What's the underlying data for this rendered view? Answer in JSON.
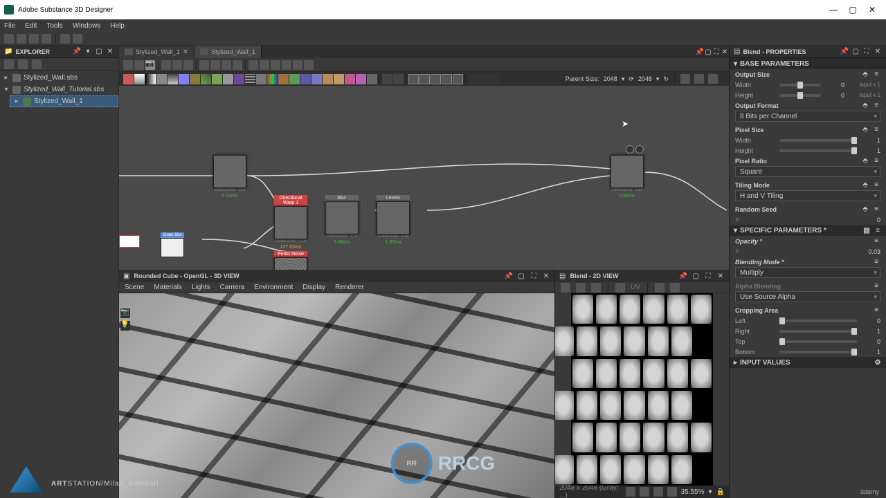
{
  "app_title": "Adobe Substance 3D Designer",
  "menu": {
    "file": "File",
    "edit": "Edit",
    "tools": "Tools",
    "windows": "Windows",
    "help": "Help"
  },
  "explorer": {
    "title": "EXPLORER",
    "items": [
      {
        "label": "Stylized_Wall.sbs",
        "indent": 0,
        "twisty": "▸"
      },
      {
        "label": "Stylized_Wall_Tutorial.sbs",
        "indent": 0,
        "twisty": "▾",
        "italic": true
      },
      {
        "label": "Stylized_Wall_1",
        "indent": 1,
        "twisty": "▸",
        "selected": true
      }
    ]
  },
  "tabs": [
    {
      "label": "Stylized_Wall_1",
      "active": false
    },
    {
      "label": "Stylized_Wall_1",
      "active": true
    }
  ],
  "parent_size": {
    "label": "Parent Size:",
    "value": "2048",
    "local": "2048"
  },
  "nodes": {
    "tile": {
      "caption": "2048x2048 - L16",
      "time": "0.31ms"
    },
    "blend1": {
      "caption": "2048x2048 - L16",
      "time": "127.03ms",
      "name": "Directional Warp 1"
    },
    "blur": {
      "caption": "2048x2048 - L16",
      "time": "5.86ms",
      "name": "Blur"
    },
    "levels": {
      "caption": "2048x2048 - L16",
      "time": "1.03ms",
      "name": "Levels"
    },
    "out": {
      "caption": "2048x2048 - L16",
      "time": "0.63ms"
    },
    "perlin": {
      "caption": "",
      "name": "Perlin Noise"
    }
  },
  "view3d": {
    "title": "Rounded Cube - OpenGL - 3D VIEW",
    "menu": {
      "scene": "Scene",
      "materials": "Materials",
      "lights": "Lights",
      "camera": "Camera",
      "environment": "Environment",
      "display": "Display",
      "renderer": "Renderer"
    }
  },
  "view2d": {
    "title": "Blend - 2D VIEW",
    "uv": "UV",
    "status_px": "2048 x 2048 (Gray; ...)",
    "zoom": "35.55%"
  },
  "properties": {
    "title": "Blend - PROPERTIES",
    "base_params": "BASE PARAMETERS",
    "output_size": "Output Size",
    "width": "Width",
    "height": "Height",
    "width_val": "0",
    "height_val": "0",
    "width_ex": "Input x 1",
    "height_ex": "Input x 1",
    "output_format": "Output Format",
    "output_format_val": "8 Bits per Channel",
    "pixel_size": "Pixel Size",
    "ps_width_val": "1",
    "ps_height_val": "1",
    "pixel_ratio": "Pixel Ratio",
    "pixel_ratio_val": "Square",
    "tiling_mode": "Tiling Mode",
    "tiling_val": "H and V Tiling",
    "random_seed": "Random Seed",
    "seed_val": "0",
    "specific": "SPECIFIC PARAMETERS *",
    "opacity": "Opacity *",
    "opacity_val": "0.03",
    "blending_mode": "Blending Mode *",
    "blending_val": "Multiply",
    "alpha_blending": "Alpha Blending",
    "alpha_val": "Use Source Alpha",
    "cropping": "Cropping Area",
    "left": "Left",
    "right_l": "Right",
    "top": "Top",
    "bottom": "Bottom",
    "left_v": "0",
    "right_v": "1",
    "top_v": "0",
    "bottom_v": "1",
    "input_values": "INPUT VALUES"
  },
  "watermark": {
    "text1": "ART",
    "text2": "STATION",
    "text3": "/Milad_Kambari"
  },
  "rrcg": {
    "logo": "RR",
    "text": "RRCG"
  },
  "udemy": "ûdemy"
}
